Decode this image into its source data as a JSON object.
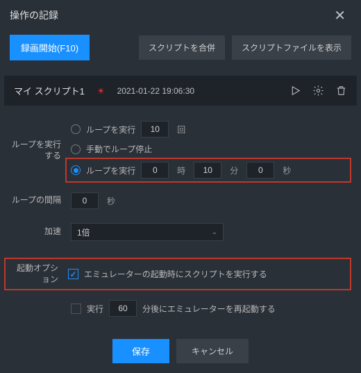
{
  "title": "操作の記録",
  "toolbar": {
    "record": "録画開始(F10)",
    "merge": "スクリプトを合併",
    "showFile": "スクリプトファイルを表示"
  },
  "script": {
    "name": "マイ スクリプト1",
    "timestamp": "2021-01-22 19:06:30"
  },
  "labels": {
    "loopExecute": "ループを実行する",
    "loopInterval": "ループの間隔",
    "accel": "加速",
    "startupOptions": "起動オプション"
  },
  "radio": {
    "loopCount": "ループを実行",
    "countVal": "10",
    "countUnit": "回",
    "manualStop": "手動でループ停止",
    "loopTime": "ループを実行",
    "h": "0",
    "hU": "時",
    "m": "10",
    "mU": "分",
    "s": "0",
    "sU": "秒"
  },
  "interval": {
    "val": "0",
    "unit": "秒"
  },
  "accel": {
    "selected": "1倍"
  },
  "startup": {
    "runOnStart": "エミュレーターの起動時にスクリプトを実行する",
    "runAfter": "実行",
    "runAfterVal": "60",
    "runAfterUnit": "分後にエミュレーターを再起動する"
  },
  "footer": {
    "save": "保存",
    "cancel": "キャンセル"
  }
}
